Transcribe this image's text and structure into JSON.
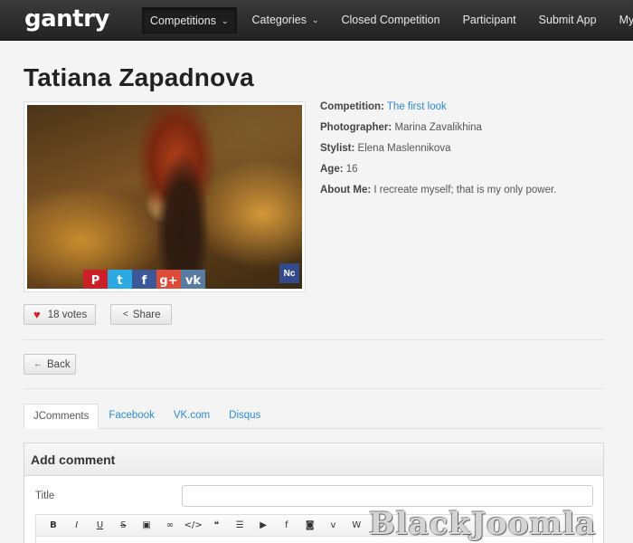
{
  "logo": {
    "text": "gantry"
  },
  "nav": {
    "items": [
      {
        "label": "Competitions",
        "caret": true,
        "active": true
      },
      {
        "label": "Categories",
        "caret": true,
        "active": false
      },
      {
        "label": "Closed Competition",
        "caret": false,
        "active": false
      },
      {
        "label": "Participant",
        "caret": false,
        "active": false
      },
      {
        "label": "Submit App",
        "caret": false,
        "active": false
      },
      {
        "label": "My Apps",
        "caret": false,
        "active": false
      }
    ]
  },
  "page": {
    "title": "Tatiana Zapadnova"
  },
  "photo": {
    "badge": "Nc",
    "share_icons": [
      {
        "name": "pinterest-icon",
        "glyph": "P",
        "color": "#cb2027"
      },
      {
        "name": "twitter-icon",
        "glyph": "t",
        "color": "#2ba9e1"
      },
      {
        "name": "facebook-icon",
        "glyph": "f",
        "color": "#3b5998"
      },
      {
        "name": "google-plus-icon",
        "glyph": "g+",
        "color": "#dd4b39"
      },
      {
        "name": "vk-icon",
        "glyph": "vk",
        "color": "#587ba1"
      }
    ]
  },
  "details": {
    "competition_label": "Competition:",
    "competition_value": "The first look",
    "photographer_label": "Photographer:",
    "photographer_value": "Marina Zavalikhina",
    "stylist_label": "Stylist:",
    "stylist_value": "Elena Maslennikova",
    "age_label": "Age:",
    "age_value": "16",
    "about_label": "About Me:",
    "about_value": "I recreate myself; that is my only power."
  },
  "actions": {
    "votes_label": "18 votes",
    "share_label": "Share",
    "back_label": "Back"
  },
  "tabs": [
    {
      "label": "JComments",
      "active": true
    },
    {
      "label": "Facebook",
      "active": false
    },
    {
      "label": "VK.com",
      "active": false
    },
    {
      "label": "Disqus",
      "active": false
    }
  ],
  "comment": {
    "heading": "Add comment",
    "title_label": "Title",
    "title_value": "",
    "toolbar": [
      {
        "name": "bold-icon",
        "glyph": "B"
      },
      {
        "name": "italic-icon",
        "glyph": "I"
      },
      {
        "name": "underline-icon",
        "glyph": "U"
      },
      {
        "name": "strikethrough-icon",
        "glyph": "S"
      },
      {
        "name": "image-icon",
        "glyph": "▣"
      },
      {
        "name": "link-icon",
        "glyph": "∞"
      },
      {
        "name": "code-icon",
        "glyph": "</>"
      },
      {
        "name": "quote-icon",
        "glyph": "❝"
      },
      {
        "name": "list-icon",
        "glyph": "☰"
      },
      {
        "name": "youtube-icon",
        "glyph": "▶"
      },
      {
        "name": "facebook-icon",
        "glyph": "f"
      },
      {
        "name": "instagram-icon",
        "glyph": "◙"
      },
      {
        "name": "vimeo-icon",
        "glyph": "v"
      },
      {
        "name": "wiki-icon",
        "glyph": "W"
      },
      {
        "name": "smiley-icon",
        "glyph": "☺"
      }
    ]
  },
  "watermark": {
    "text": "BlackJoomla"
  }
}
